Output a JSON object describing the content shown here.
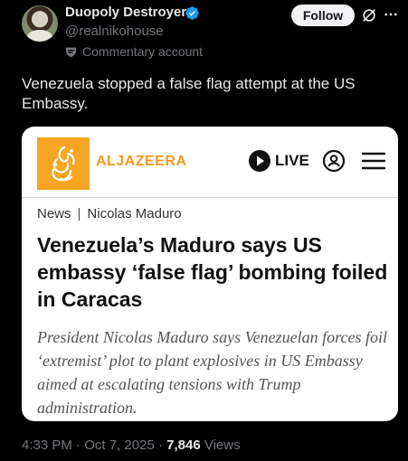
{
  "author": {
    "display_name": "Duopoly Destroyer",
    "handle": "@realnikohouse",
    "account_label": "Commentary account",
    "verified_icon": "verified-badge-icon",
    "verified_color": "#1d9bf0"
  },
  "actions": {
    "follow_label": "Follow",
    "grok_icon": "grok-icon",
    "more_icon": "more-horizontal-icon"
  },
  "tweet": {
    "text": "Venezuela stopped a false flag attempt at the US Embassy."
  },
  "card": {
    "brand": "ALJAZEERA",
    "brand_color": "#f6a623",
    "live_label": "LIVE",
    "breadcrumb": {
      "section": "News",
      "separator": "|",
      "topic": "Nicolas Maduro"
    },
    "headline": "Venezuela’s Maduro says US embassy ‘false flag’ bombing foiled in Caracas",
    "summary": "President Nicolas Maduro says Venezuelan forces foil ‘extremist’ plot to plant explosives in US Embassy aimed at escalating tensions with Trump administration."
  },
  "meta": {
    "time": "4:33 PM",
    "date": "Oct 7, 2025",
    "dot": "·",
    "views_count": "7,846",
    "views_label": "Views"
  }
}
